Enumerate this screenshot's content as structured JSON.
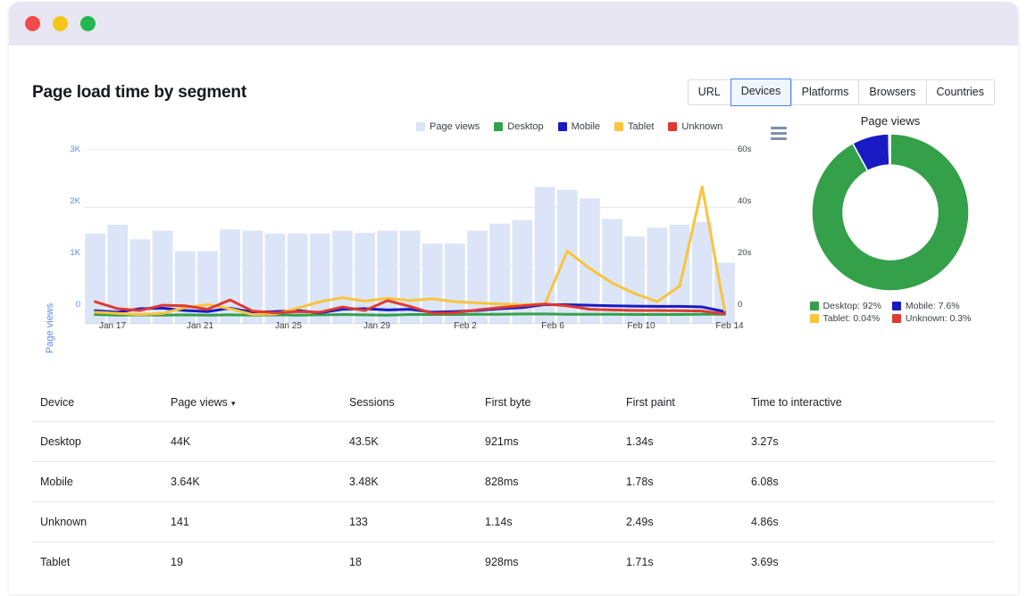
{
  "window": {
    "traffic_lights": [
      "close",
      "minimize",
      "maximize"
    ]
  },
  "header": {
    "title": "Page load time by segment",
    "tabs": [
      {
        "label": "URL",
        "active": false
      },
      {
        "label": "Devices",
        "active": true
      },
      {
        "label": "Platforms",
        "active": false
      },
      {
        "label": "Browsers",
        "active": false
      },
      {
        "label": "Countries",
        "active": false
      }
    ]
  },
  "legend": [
    {
      "label": "Page views",
      "color": "#dbe5f7"
    },
    {
      "label": "Desktop",
      "color": "#35a04a"
    },
    {
      "label": "Mobile",
      "color": "#1a1ac4"
    },
    {
      "label": "Tablet",
      "color": "#fac43c"
    },
    {
      "label": "Unknown",
      "color": "#e03a30"
    }
  ],
  "menu_icon": "hamburger-menu-icon",
  "donut": {
    "title": "Page views",
    "legend": [
      {
        "label": "Desktop: 92%",
        "color": "#35a04a"
      },
      {
        "label": "Mobile: 7.6%",
        "color": "#1a1ac4"
      },
      {
        "label": "Tablet: 0.04%",
        "color": "#fac43c"
      },
      {
        "label": "Unknown: 0.3%",
        "color": "#e03a30"
      }
    ]
  },
  "table": {
    "columns": [
      "Device",
      "Page views",
      "Sessions",
      "First byte",
      "First paint",
      "Time to interactive"
    ],
    "sorted_column": "Page views",
    "sort_direction": "desc",
    "rows": [
      {
        "device": "Desktop",
        "page_views": "44K",
        "sessions": "43.5K",
        "first_byte": "921ms",
        "first_paint": "1.34s",
        "tti": "3.27s"
      },
      {
        "device": "Mobile",
        "page_views": "3.64K",
        "sessions": "3.48K",
        "first_byte": "828ms",
        "first_paint": "1.78s",
        "tti": "6.08s"
      },
      {
        "device": "Unknown",
        "page_views": "141",
        "sessions": "133",
        "first_byte": "1.14s",
        "first_paint": "2.49s",
        "tti": "4.86s"
      },
      {
        "device": "Tablet",
        "page_views": "19",
        "sessions": "18",
        "first_byte": "928ms",
        "first_paint": "1.71s",
        "tti": "3.69s"
      }
    ]
  },
  "chart_data": [
    {
      "type": "bar",
      "title": "",
      "xlabel": "",
      "ylabel": "Page views",
      "y2label": "",
      "ylim": [
        0,
        3000
      ],
      "y2lim": [
        0,
        60
      ],
      "yticks": [
        "0",
        "1K",
        "2K",
        "3K"
      ],
      "y2ticks": [
        "0",
        "20s",
        "40s",
        "60s"
      ],
      "grid": true,
      "legend_position": "top-right",
      "x": [
        "Jan 17",
        "Jan 18",
        "Jan 19",
        "Jan 20",
        "Jan 21",
        "Jan 22",
        "Jan 23",
        "Jan 24",
        "Jan 25",
        "Jan 26",
        "Jan 27",
        "Jan 28",
        "Jan 29",
        "Jan 30",
        "Jan 31",
        "Feb 1",
        "Feb 2",
        "Feb 3",
        "Feb 4",
        "Feb 5",
        "Feb 6",
        "Feb 7",
        "Feb 8",
        "Feb 9",
        "Feb 10",
        "Feb 11",
        "Feb 12",
        "Feb 13",
        "Feb 14"
      ],
      "xtick_labels": [
        "Jan 17",
        "Jan 21",
        "Jan 25",
        "Jan 29",
        "Feb 2",
        "Feb 6",
        "Feb 10",
        "Feb 14"
      ],
      "categories": [
        "Jan 17",
        "Jan 18",
        "Jan 19",
        "Jan 20",
        "Jan 21",
        "Jan 22",
        "Jan 23",
        "Jan 24",
        "Jan 25",
        "Jan 26",
        "Jan 27",
        "Jan 28",
        "Jan 29",
        "Jan 30",
        "Jan 31",
        "Feb 1",
        "Feb 2",
        "Feb 3",
        "Feb 4",
        "Feb 5",
        "Feb 6",
        "Feb 7",
        "Feb 8",
        "Feb 9",
        "Feb 10",
        "Feb 11",
        "Feb 12",
        "Feb 13",
        "Feb 14"
      ],
      "values": [
        1550,
        1700,
        1450,
        1600,
        1250,
        1250,
        1620,
        1600,
        1550,
        1550,
        1550,
        1600,
        1560,
        1600,
        1600,
        1380,
        1380,
        1600,
        1720,
        1780,
        2350,
        2300,
        2150,
        1800,
        1500,
        1650,
        1700,
        1750,
        1050
      ],
      "series": [
        {
          "name": "Page views",
          "type": "bar",
          "axis": "left",
          "color": "#dbe5f7",
          "values": [
            1550,
            1700,
            1450,
            1600,
            1250,
            1250,
            1620,
            1600,
            1550,
            1550,
            1550,
            1600,
            1560,
            1600,
            1600,
            1380,
            1380,
            1600,
            1720,
            1780,
            2350,
            2300,
            2150,
            1800,
            1500,
            1650,
            1700,
            1750,
            1050
          ]
        },
        {
          "name": "Desktop",
          "type": "line",
          "axis": "right",
          "color": "#35a04a",
          "values": [
            3.2,
            3.0,
            3.1,
            3.0,
            3.1,
            3.0,
            3.1,
            3.0,
            3.1,
            3.0,
            3.1,
            3.2,
            3.1,
            3.0,
            3.2,
            3.2,
            3.2,
            3.3,
            3.3,
            3.4,
            3.4,
            3.3,
            3.3,
            3.3,
            3.2,
            3.2,
            3.2,
            3.3,
            3.3
          ]
        },
        {
          "name": "Mobile",
          "type": "line",
          "axis": "right",
          "color": "#1a1ac4",
          "values": [
            4.5,
            4.0,
            5.2,
            5.4,
            4.6,
            4.2,
            5.4,
            4.0,
            4.2,
            4.6,
            3.8,
            5.0,
            5.2,
            4.8,
            5.0,
            4.0,
            4.2,
            4.6,
            5.2,
            5.6,
            6.6,
            6.6,
            6.4,
            6.2,
            6.1,
            6.0,
            6.0,
            5.8,
            4.2
          ]
        },
        {
          "name": "Tablet",
          "type": "line",
          "axis": "right",
          "color": "#fac43c",
          "values": [
            4.0,
            3.6,
            3.2,
            3.6,
            5.6,
            6.6,
            5.2,
            3.2,
            3.4,
            5.4,
            7.6,
            9.0,
            7.8,
            8.8,
            8.0,
            8.6,
            7.6,
            7.2,
            6.8,
            6.6,
            6.8,
            25.0,
            19.0,
            14.0,
            10.4,
            7.6,
            13.0,
            47.0,
            4.6
          ]
        },
        {
          "name": "Unknown",
          "type": "line",
          "axis": "right",
          "color": "#e03a30",
          "values": [
            7.6,
            5.2,
            4.6,
            6.4,
            6.2,
            5.0,
            8.2,
            4.4,
            3.8,
            4.2,
            4.0,
            5.8,
            4.6,
            8.0,
            6.0,
            3.6,
            3.8,
            4.8,
            5.6,
            6.2,
            6.8,
            6.2,
            5.0,
            4.8,
            4.6,
            4.6,
            4.5,
            4.4,
            3.4
          ]
        }
      ]
    },
    {
      "type": "pie",
      "variant": "donut",
      "title": "Page views",
      "labels": [
        "Desktop",
        "Mobile",
        "Tablet",
        "Unknown"
      ],
      "values": [
        92,
        7.6,
        0.04,
        0.3
      ],
      "colors": [
        "#35a04a",
        "#1a1ac4",
        "#fac43c",
        "#e03a30"
      ],
      "legend_position": "bottom"
    }
  ]
}
